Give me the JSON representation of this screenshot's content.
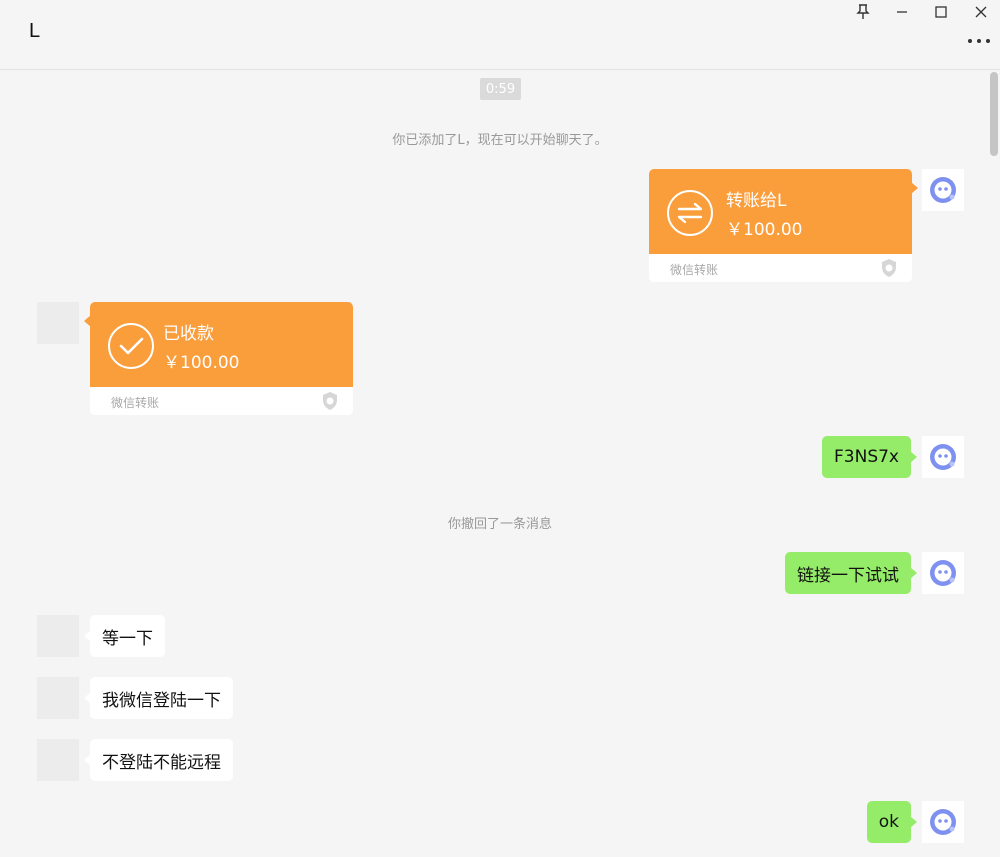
{
  "window": {
    "title": "L",
    "pin_icon": "pin-icon",
    "minimize_icon": "minimize-icon",
    "maximize_icon": "maximize-icon",
    "close_icon": "close-icon",
    "more_icon": "more-icon"
  },
  "chat": {
    "timestamp": "0:59",
    "system_added": "你已添加了L，现在可以开始聊天了。",
    "system_recalled": "你撤回了一条消息",
    "transfer_sent": {
      "title": "转账给L",
      "amount": "￥100.00",
      "footer": "微信转账"
    },
    "transfer_received": {
      "title": "已收款",
      "amount": "￥100.00",
      "footer": "微信转账"
    },
    "messages": [
      {
        "from": "me",
        "text": "F3NS7x"
      },
      {
        "from": "me",
        "text": "链接一下试试"
      },
      {
        "from": "other",
        "text": "等一下"
      },
      {
        "from": "other",
        "text": "我微信登陆一下"
      },
      {
        "from": "other",
        "text": "不登陆不能远程"
      },
      {
        "from": "me",
        "text": "ok"
      }
    ]
  },
  "colors": {
    "transfer_orange": "#fa9d3b",
    "my_bubble": "#95ec69",
    "other_bubble": "#ffffff",
    "background": "#f5f5f5"
  }
}
